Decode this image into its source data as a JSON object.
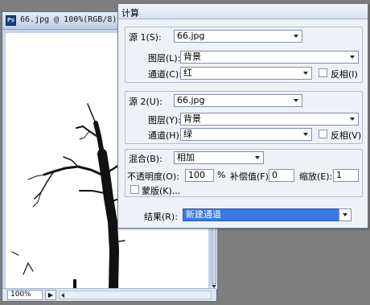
{
  "doc_window": {
    "ps_badge": "Ps",
    "title": "66.jpg @ 100%(RGB/8)",
    "status": {
      "zoom": "100%"
    }
  },
  "dialog": {
    "title": "计算",
    "source1": {
      "label": "源 1(S):",
      "file": "66.jpg",
      "layer_label": "图层(L):",
      "layer": "背景",
      "channel_label": "通道(C):",
      "channel": "红",
      "invert_label": "反相(I)"
    },
    "source2": {
      "label": "源 2(U):",
      "file": "66.jpg",
      "layer_label": "图层(Y):",
      "layer": "背景",
      "channel_label": "通道(H):",
      "channel": "绿",
      "invert_label": "反相(V)"
    },
    "blending": {
      "label": "混合(B):",
      "mode": "相加",
      "opacity_label": "不透明度(O):",
      "opacity": "100",
      "percent": "%",
      "offset_label": "补偿值(F):",
      "offset": "0",
      "scale_label": "缩放(E):",
      "scale": "1",
      "mask_label": "蒙版(K)..."
    },
    "result": {
      "label": "结果(R):",
      "value": "新建通道"
    }
  },
  "colors": {
    "selection": "#3a79e0",
    "ps_icon": "#1c3f7a",
    "dialog_bg": "#eef1f6"
  }
}
